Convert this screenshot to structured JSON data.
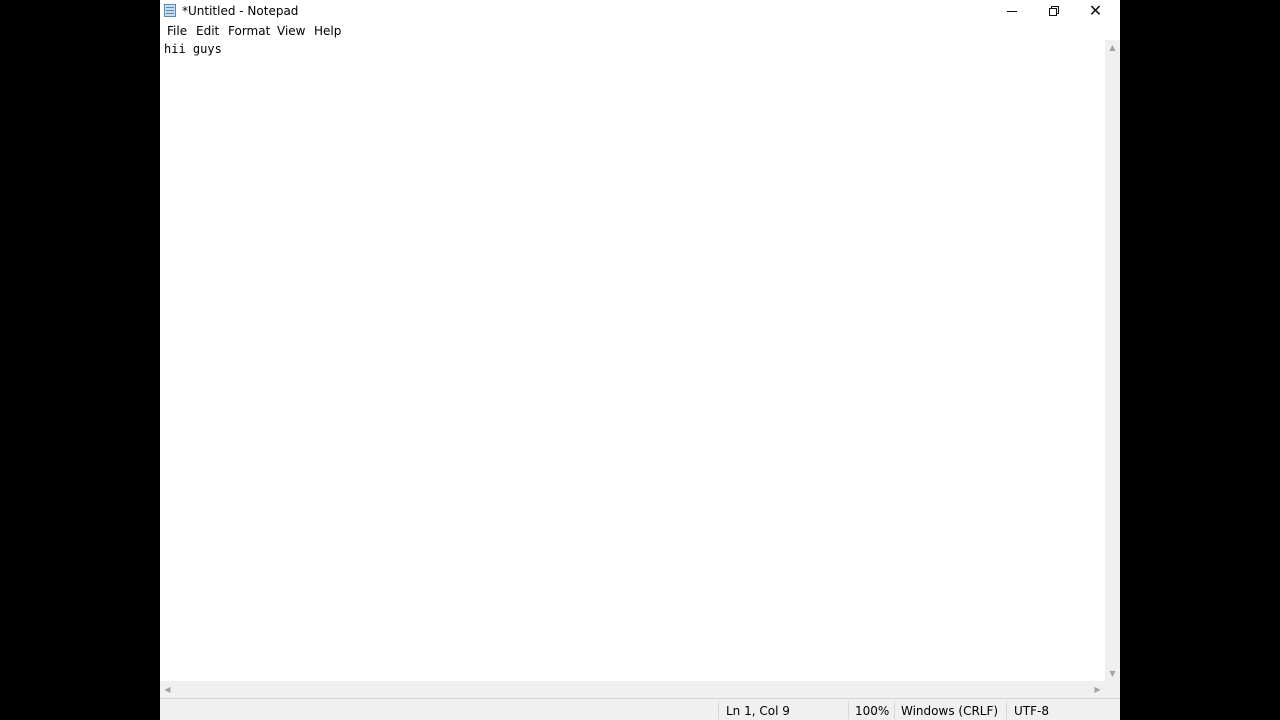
{
  "window": {
    "title": "*Untitled - Notepad",
    "controls": {
      "minimize": "minimize",
      "maximize": "restore",
      "close": "✕"
    }
  },
  "menu": {
    "items": [
      {
        "label": "File"
      },
      {
        "label": "Edit"
      },
      {
        "label": "Format"
      },
      {
        "label": "View"
      },
      {
        "label": "Help"
      }
    ]
  },
  "editor": {
    "content": "hii guys"
  },
  "scrollbars": {
    "up": "▲",
    "down": "▼",
    "left": "◀",
    "right": "▶"
  },
  "status": {
    "position": "Ln 1, Col 9",
    "zoom": "100%",
    "line_ending": "Windows (CRLF)",
    "encoding": "UTF-8"
  },
  "icons": {
    "app": "notepad-icon"
  }
}
